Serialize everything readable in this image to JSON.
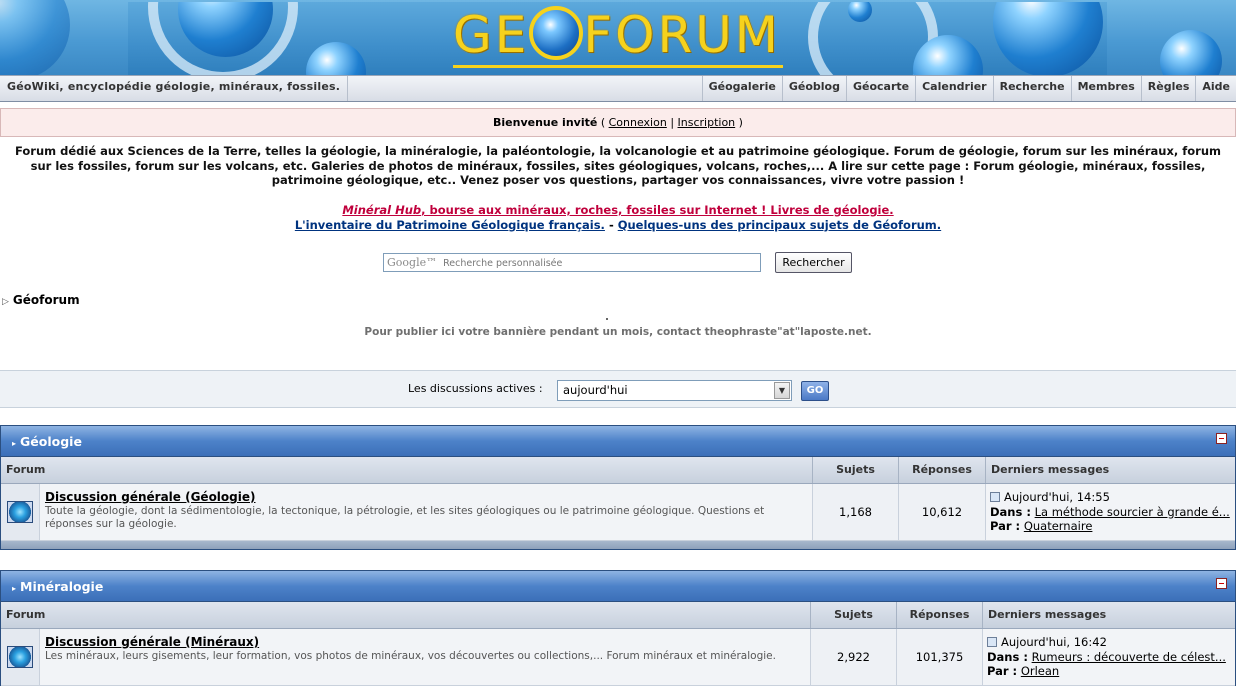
{
  "banner": {
    "logo_left": "GE",
    "logo_right": "FORUM"
  },
  "nav": {
    "left_label": "GéoWiki, encyclopédie géologie, minéraux, fossiles.",
    "items": [
      "Géogalerie",
      "Géoblog",
      "Géocarte",
      "Calendrier",
      "Recherche",
      "Membres",
      "Règles",
      "Aide"
    ]
  },
  "welcome": {
    "prefix": "Bienvenue invité",
    "login": "Connexion",
    "register": "Inscription"
  },
  "description": "Forum dédié aux Sciences de la Terre, telles la géologie, la minéralogie, la paléontologie, la volcanologie et au patrimoine géologique. Forum de géologie, forum sur les minéraux, forum sur les fossiles, forum sur les volcans, etc. Galeries de photos de minéraux, fossiles, sites géologiques, volcans, roches,... A lire sur cette page : Forum géologie, minéraux, fossiles, patrimoine géologique, etc.. Venez poser vos questions, partager vos connaissances, vivre votre passion !",
  "promo": {
    "mineral_hub": "Minéral Hub",
    "mineral_hub_rest": ", bourse aux minéraux, roches, fossiles sur Internet ! Livres de géologie.",
    "inventaire": "L'inventaire du Patrimoine Géologique français.",
    "sep": " - ",
    "sujets": "Quelques-uns des principaux sujets de Géoforum."
  },
  "search": {
    "google": "Google™",
    "placeholder": "Recherche personnalisée",
    "button": "Rechercher"
  },
  "breadcrumb": "Géoforum",
  "publish_note": "Pour publier ici votre bannière pendant un mois, contact theophraste\"at\"laposte.net.",
  "active": {
    "label": "Les discussions actives  :",
    "selected": "aujourd'hui",
    "go": "GO"
  },
  "columns": {
    "forum": "Forum",
    "topics": "Sujets",
    "replies": "Réponses",
    "last": "Derniers messages"
  },
  "categories": [
    {
      "title": "Géologie",
      "forum": {
        "name": "Discussion générale (Géologie)",
        "description": "Toute la géologie, dont la sédimentologie, la tectonique, la pétrologie, et les sites géologiques ou le patrimoine géologique. Questions et réponses sur la géologie.",
        "topics": "1,168",
        "replies": "10,612",
        "last_date": "Aujourd'hui, 14:55",
        "in_label": "Dans :",
        "in_thread": "La méthode sourcier à grande é...",
        "by_label": "Par :",
        "by_user": "Quaternaire"
      }
    },
    {
      "title": "Minéralogie",
      "forum": {
        "name": "Discussion générale (Minéraux)",
        "description": "Les minéraux, leurs gisements, leur formation, vos photos de minéraux, vos découvertes ou collections,... Forum minéraux et minéralogie.",
        "topics": "2,922",
        "replies": "101,375",
        "last_date": "Aujourd'hui, 16:42",
        "in_label": "Dans :",
        "in_thread": "Rumeurs : découverte de célest...",
        "by_label": "Par :",
        "by_user": "Orlean"
      }
    }
  ]
}
